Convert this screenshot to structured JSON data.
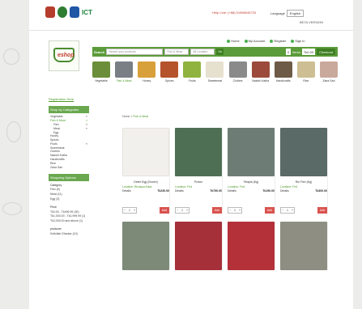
{
  "header": {
    "brand": "ICT",
    "help_line": "Help Line: (+88) 01556045720",
    "language_label": "Language",
    "language_value": "English",
    "beta": "BETA VERSION"
  },
  "account_links": [
    "Home",
    "My Account",
    "Register",
    "Sign in"
  ],
  "logo_text": "eshop",
  "search": {
    "label": "Search",
    "placeholder": "Search your products",
    "category_value": "Fish & Meat",
    "location_value": "All Location",
    "go": "Go",
    "cart_count": "0",
    "cart_items_label": "Items",
    "cart_total": "Tk0.00",
    "checkout": "Checkout"
  },
  "categories": [
    {
      "label": "Vegetable",
      "color": "#6b8e3a"
    },
    {
      "label": "Fish & Meat",
      "color": "#7a7f86"
    },
    {
      "label": "Honey",
      "color": "#d8a03a"
    },
    {
      "label": "Spices",
      "color": "#b5532c"
    },
    {
      "label": "Fruits",
      "color": "#8fb33e"
    },
    {
      "label": "Sweetmeat",
      "color": "#e6e0cf"
    },
    {
      "label": "Clothes",
      "color": "#8a8a8a"
    },
    {
      "label": "Nakshi Katha",
      "color": "#9c4a3c"
    },
    {
      "label": "Handicrafts",
      "color": "#6d5b47"
    },
    {
      "label": "Rice",
      "color": "#cdbf93"
    },
    {
      "label": "Zaira Sari",
      "color": "#c9a99c"
    }
  ],
  "sidebar": {
    "registration_link": "Registration Here",
    "shop_by_categories": "Shop by Categories",
    "items": [
      {
        "label": "Vegetable",
        "arrow": "»",
        "level": 0
      },
      {
        "label": "Fish & Meat",
        "arrow": "»",
        "level": 0,
        "active": true
      },
      {
        "label": "Fish",
        "arrow": "»",
        "level": 1
      },
      {
        "label": "Meat",
        "arrow": "»",
        "level": 1
      },
      {
        "label": "Egg",
        "arrow": "",
        "level": 1
      },
      {
        "label": "Honey",
        "arrow": "",
        "level": 0
      },
      {
        "label": "Spices",
        "arrow": "",
        "level": 0
      },
      {
        "label": "Fruits",
        "arrow": "»",
        "level": 0
      },
      {
        "label": "Sweetmeat",
        "arrow": "",
        "level": 0
      },
      {
        "label": "Clothes",
        "arrow": "",
        "level": 0
      },
      {
        "label": "Nakshi Katha",
        "arrow": "",
        "level": 0
      },
      {
        "label": "Handicrafts",
        "arrow": "",
        "level": 0
      },
      {
        "label": "Rice",
        "arrow": "",
        "level": 0
      },
      {
        "label": "Zaira Sari",
        "arrow": "",
        "level": 0
      }
    ],
    "shopping_options": "Shopping Options",
    "category_heading": "Category",
    "category_opts": [
      "Fish (6)",
      "Meat (11)",
      "Egg (3)"
    ],
    "price_heading": "Price",
    "price_opts": [
      "Tk0.00 - Tk499.99 (30)",
      "Tk1,000.00 - Tk1,999.99 (1)",
      "Tk2,000.00 and above (1)"
    ],
    "producer_heading": "producer",
    "producer_opts": [
      "Sofiullah Sharkar (10)"
    ]
  },
  "breadcrumb": {
    "home": "Home",
    "sep": ">",
    "current": "Fish & Meat"
  },
  "products": [
    {
      "name": "Deshi Egg (Dozen)",
      "location": "Location: Bhuapur/Akar",
      "details": "Details",
      "price": "Tk230.00",
      "qty": "1",
      "add": "Add",
      "color": "#f2f0ec"
    },
    {
      "name": "Prawn",
      "location": "Location: Fed",
      "details": "Details",
      "price": "Tk750.00",
      "qty": "1",
      "add": "Add",
      "color": "#4f6f55"
    },
    {
      "name": "Telapia (Kg)",
      "location": "Location: Fed",
      "details": "Details",
      "price": "Tk190.00",
      "qty": "1",
      "add": "Add",
      "color": "#6d7d76"
    },
    {
      "name": "Rui Fish (Kg)",
      "location": "Location: Fed",
      "details": "Details",
      "price": "Tk300.00",
      "qty": "1",
      "add": "Add",
      "color": "#5a6a66"
    },
    {
      "name": "",
      "location": "",
      "details": "",
      "price": "",
      "qty": "",
      "add": "",
      "color": "#7d8a78"
    },
    {
      "name": "",
      "location": "",
      "details": "",
      "price": "",
      "qty": "",
      "add": "",
      "color": "#a5303a"
    },
    {
      "name": "",
      "location": "",
      "details": "",
      "price": "",
      "qty": "",
      "add": "",
      "color": "#b4313a"
    },
    {
      "name": "",
      "location": "",
      "details": "",
      "price": "",
      "qty": "",
      "add": "",
      "color": "#8e8e82"
    }
  ]
}
